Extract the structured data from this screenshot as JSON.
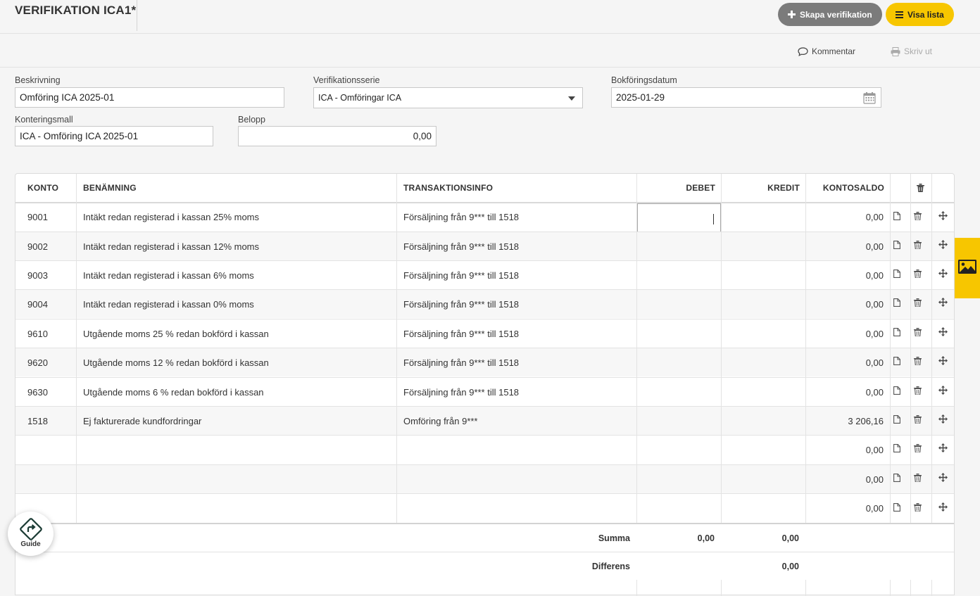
{
  "header": {
    "title": "VERIFIKATION ICA1*",
    "create_button": "Skapa verifikation",
    "list_button": "Visa lista",
    "accent_yellow": "#f7c600",
    "grey_button": "#7b7b7b"
  },
  "toolbar": {
    "comment_label": "Kommentar",
    "print_label": "Skriv ut"
  },
  "form": {
    "description_label": "Beskrivning",
    "description_value": "Omföring ICA 2025-01",
    "series_label": "Verifikationsserie",
    "series_value": "ICA - Omföringar ICA",
    "date_label": "Bokföringsdatum",
    "date_value": "2025-01-29",
    "template_label": "Konteringsmall",
    "template_value": "ICA - Omföring ICA 2025-01",
    "amount_label": "Belopp",
    "amount_value": "0,00"
  },
  "table": {
    "headers": {
      "konto": "KONTO",
      "benamning": "BENÄMNING",
      "transaktionsinfo": "TRANSAKTIONSINFO",
      "debet": "DEBET",
      "kredit": "KREDIT",
      "kontosaldo": "KONTOSALDO"
    },
    "rows": [
      {
        "konto": "9001",
        "benamning": "Intäkt redan registerad i kassan 25% moms",
        "info": "Försäljning från 9*** till 1518",
        "debet": "",
        "kredit": "",
        "saldo": "0,00"
      },
      {
        "konto": "9002",
        "benamning": "Intäkt redan registerad i kassan 12% moms",
        "info": "Försäljning från 9*** till 1518",
        "debet": "",
        "kredit": "",
        "saldo": "0,00"
      },
      {
        "konto": "9003",
        "benamning": "Intäkt redan registerad i kassan 6% moms",
        "info": "Försäljning från 9*** till 1518",
        "debet": "",
        "kredit": "",
        "saldo": "0,00"
      },
      {
        "konto": "9004",
        "benamning": "Intäkt redan registerad i kassan 0% moms",
        "info": "Försäljning från 9*** till 1518",
        "debet": "",
        "kredit": "",
        "saldo": "0,00"
      },
      {
        "konto": "9610",
        "benamning": "Utgående moms 25 % redan bokförd i kassan",
        "info": "Försäljning från 9*** till 1518",
        "debet": "",
        "kredit": "",
        "saldo": "0,00"
      },
      {
        "konto": "9620",
        "benamning": "Utgående moms 12 % redan bokförd i kassan",
        "info": "Försäljning från 9*** till 1518",
        "debet": "",
        "kredit": "",
        "saldo": "0,00"
      },
      {
        "konto": "9630",
        "benamning": "Utgående moms 6 % redan bokförd i kassan",
        "info": "Försäljning från 9*** till 1518",
        "debet": "",
        "kredit": "",
        "saldo": "0,00"
      },
      {
        "konto": "1518",
        "benamning": "Ej fakturerade kundfordringar",
        "info": "Omföring från 9***",
        "debet": "",
        "kredit": "",
        "saldo": "3 206,16"
      },
      {
        "konto": "",
        "benamning": "",
        "info": "",
        "debet": "",
        "kredit": "",
        "saldo": "0,00"
      },
      {
        "konto": "",
        "benamning": "",
        "info": "",
        "debet": "",
        "kredit": "",
        "saldo": "0,00"
      },
      {
        "konto": "",
        "benamning": "",
        "info": "",
        "debet": "",
        "kredit": "",
        "saldo": "0,00"
      }
    ],
    "summa_label": "Summa",
    "summa_debet": "0,00",
    "summa_kredit": "0,00",
    "differens_label": "Differens",
    "differens_value": "0,00"
  },
  "guide": {
    "label": "Guide"
  },
  "icons": [
    "plus-icon",
    "list-icon",
    "comment-icon",
    "print-icon",
    "calendar-icon",
    "caret-down-icon",
    "document-icon",
    "trash-icon",
    "move-icon",
    "image-icon",
    "guide-icon"
  ]
}
